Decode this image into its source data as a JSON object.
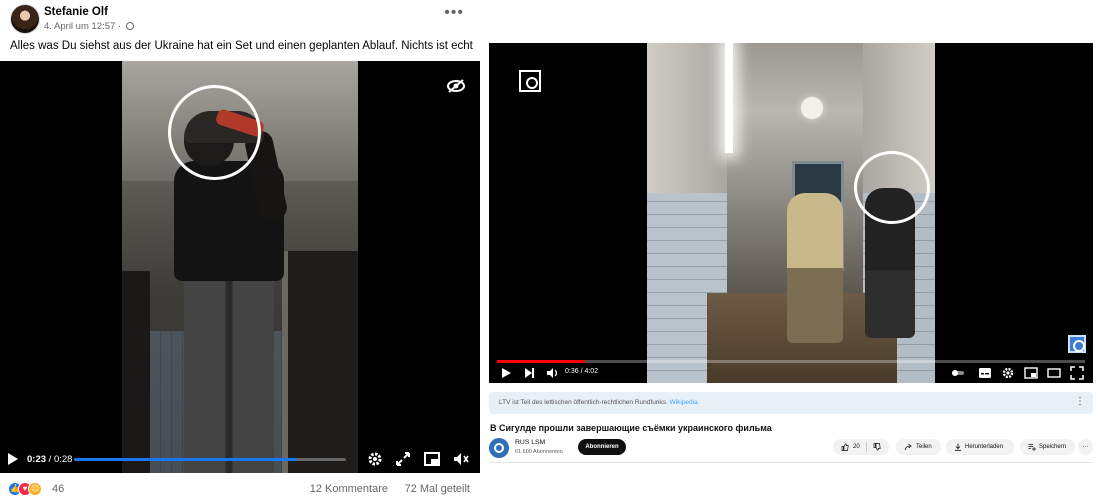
{
  "facebook": {
    "author": "Stefanie Olf",
    "timestamp": "4. April um 12:57 ·",
    "post_text": "Alles was Du siehst aus der Ukraine hat ein Set und einen geplanten Ablauf. Nichts ist echt",
    "video": {
      "time_current": "0:23",
      "time_separator": " / ",
      "time_total": "0:28",
      "progress": 0.82,
      "icons": [
        "play-icon",
        "settings-icon",
        "fullscreen-icon",
        "picture-in-picture-icon",
        "mute-icon",
        "eye-slash-icon"
      ]
    },
    "reactions_count": "46",
    "reaction_icons": [
      "like-icon",
      "love-icon",
      "sad-icon"
    ],
    "comments": "12 Kommentare",
    "shares": "72 Mal geteilt"
  },
  "youtube": {
    "video": {
      "time": "0:36 / 4:02",
      "progress": 0.149,
      "progress_color": "#ff0000",
      "icons": [
        "play-icon",
        "next-icon",
        "volume-icon",
        "autoplay-toggle",
        "subtitles-icon",
        "settings-icon",
        "miniplayer-icon",
        "theater-icon",
        "fullscreen-icon"
      ]
    },
    "info_text": "LTV ist Teil des lettischen öffentlich-rechtlichen Rundfunks.",
    "info_link": "Wikipedia",
    "title": "В Сигулде прошли завершающие съёмки украинского фильма",
    "channel_name": "RUS LSM",
    "subscribers": "61.600 Abonnenten",
    "subscribe_label": "Abonnieren",
    "likes": "20",
    "share_label": "Teilen",
    "download_label": "Herunterladen",
    "save_label": "Speichern"
  },
  "colors": {
    "facebook_blue": "#1877f2",
    "youtube_red": "#ff0000",
    "annotation_circle": "#ffffff"
  }
}
